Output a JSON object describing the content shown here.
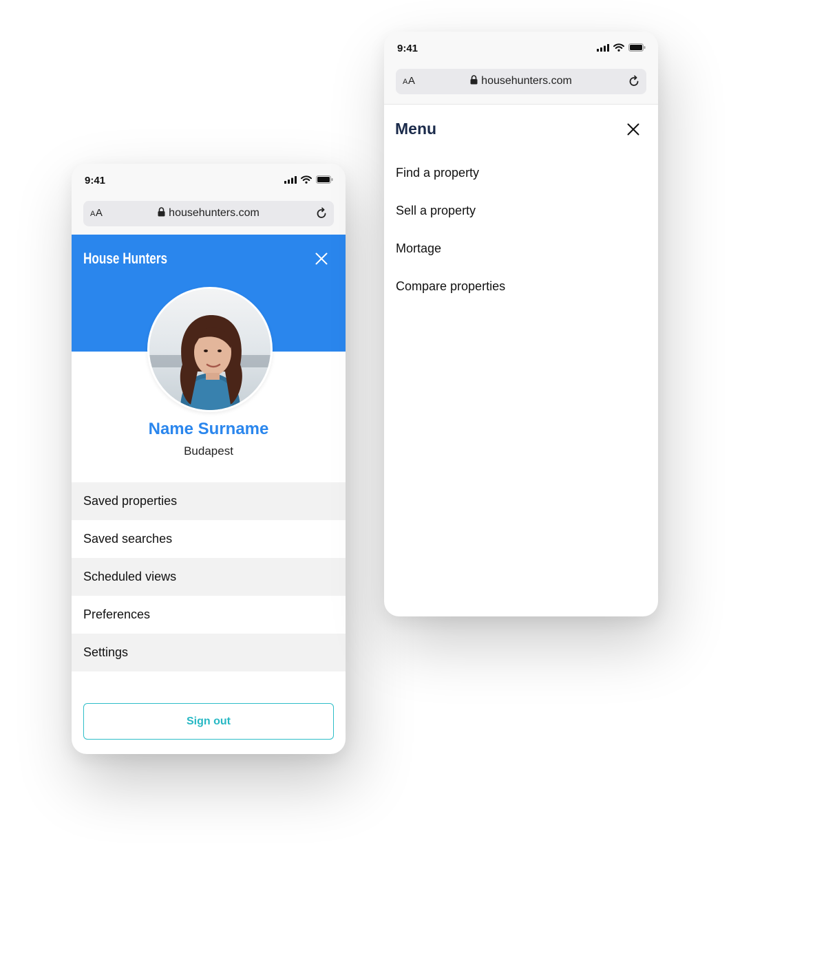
{
  "colors": {
    "brand_blue": "#2a86ed",
    "signout_teal": "#27b8c4",
    "menu_title": "#1a2a4a"
  },
  "left_phone": {
    "status": {
      "time": "9:41",
      "icons": [
        "signal-icon",
        "wifi-icon",
        "battery-icon"
      ]
    },
    "browser": {
      "aa": "AA",
      "url": "househunters.com"
    },
    "header": {
      "brand": "House Hunters",
      "close_icon": "close-icon"
    },
    "profile": {
      "name": "Name Surname",
      "city": "Budapest"
    },
    "menu": [
      {
        "label": "Saved properties"
      },
      {
        "label": "Saved searches"
      },
      {
        "label": "Scheduled views"
      },
      {
        "label": "Preferences"
      },
      {
        "label": "Settings"
      }
    ],
    "sign_out": "Sign out"
  },
  "right_phone": {
    "status": {
      "time": "9:41",
      "icons": [
        "signal-icon",
        "wifi-icon",
        "battery-icon"
      ]
    },
    "browser": {
      "aa": "AA",
      "url": "househunters.com"
    },
    "menu": {
      "title": "Menu",
      "items": [
        {
          "label": "Find a property"
        },
        {
          "label": "Sell a property"
        },
        {
          "label": "Mortage"
        },
        {
          "label": "Compare properties"
        }
      ]
    }
  }
}
